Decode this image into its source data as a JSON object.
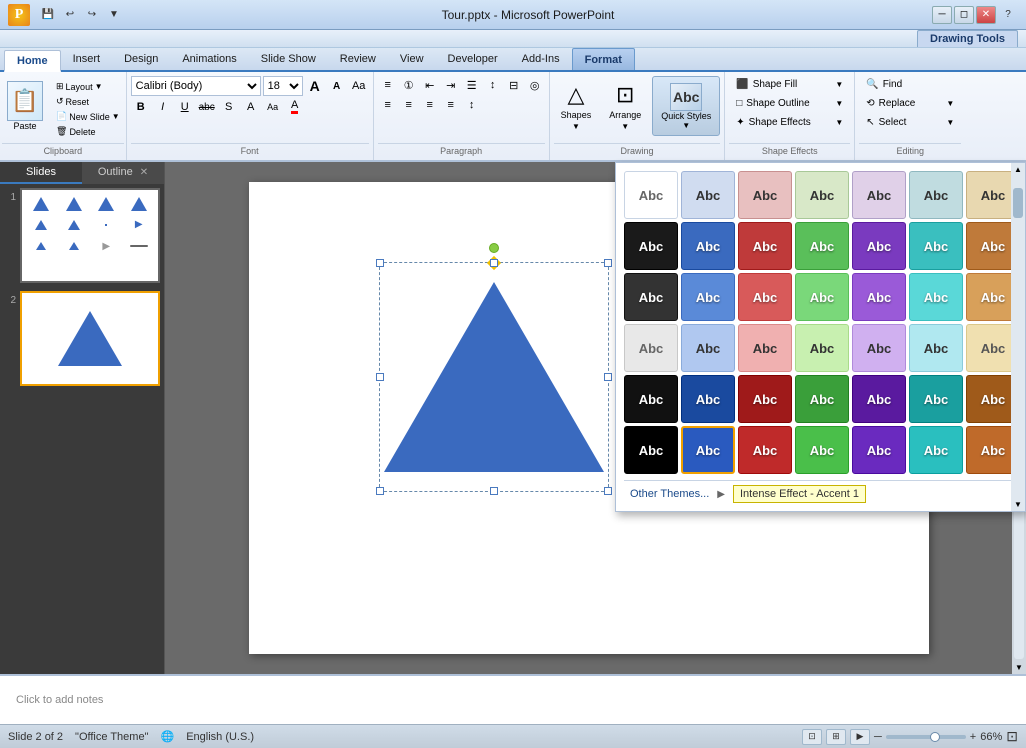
{
  "window": {
    "title": "Tour.pptx - Microsoft PowerPoint",
    "drawing_tools": "Drawing Tools"
  },
  "title_bar": {
    "title": "Tour.pptx - Microsoft PowerPoint",
    "quick_access": [
      "save",
      "undo",
      "redo",
      "customize"
    ],
    "controls": [
      "minimize",
      "restore",
      "close"
    ]
  },
  "tabs": {
    "items": [
      "Home",
      "Insert",
      "Design",
      "Animations",
      "Slide Show",
      "Review",
      "View",
      "Developer",
      "Add-Ins",
      "Format"
    ],
    "active": "Home",
    "format_tab": "Format"
  },
  "ribbon": {
    "groups": {
      "clipboard": {
        "label": "Clipboard",
        "paste": "Paste",
        "layout": "Layout",
        "reset": "Reset",
        "new_slide": "New\nSlide",
        "delete": "Delete"
      },
      "font": {
        "label": "Font",
        "font_name": "Calibri (Body)",
        "font_size": "18",
        "bold": "B",
        "italic": "I",
        "underline": "U",
        "strikethrough": "abc",
        "shadow": "S",
        "char_spacing": "A",
        "font_color": "A",
        "grow": "A",
        "shrink": "A",
        "clear": "A",
        "change_case": "Aa"
      },
      "paragraph": {
        "label": "Paragraph",
        "bullets": "≡",
        "numbering": "≡",
        "decrease": "↔",
        "increase": "↔",
        "columns": "☰",
        "align_left": "≡",
        "center": "≡",
        "align_right": "≡",
        "justify": "≡",
        "line_spacing": "≡",
        "text_direction": "A",
        "align_text": "≡",
        "convert_smartart": "◎"
      },
      "shapes": {
        "label": "Drawing",
        "shapes_btn": "Shapes",
        "arrange_btn": "Arrange",
        "quick_styles_btn": "Quick\nStyles"
      },
      "editing": {
        "label": "Editing",
        "find": "Find",
        "replace": "Replace",
        "select": "Select"
      },
      "shape_effects": {
        "label": "Shape Effects",
        "shape_fill": "Shape Fill",
        "shape_outline": "Shape Outline",
        "shape_effects": "Shape Effects"
      }
    }
  },
  "sidebar": {
    "tabs": [
      "Slides",
      "Outline"
    ],
    "active_tab": "Slides",
    "slides": [
      {
        "num": "1",
        "active": false
      },
      {
        "num": "2",
        "active": true
      }
    ]
  },
  "slide": {
    "notes_placeholder": "Click to add notes"
  },
  "quick_styles_panel": {
    "rows": [
      [
        {
          "bg": "white",
          "border": "#c8d4e4",
          "text_color": "#666",
          "style": "subtle-no-fill"
        },
        {
          "bg": "#d0dcf0",
          "border": "#a0b4d8",
          "text_color": "#333",
          "style": "subtle-light-blue"
        },
        {
          "bg": "#e8c0c0",
          "border": "#c89090",
          "text_color": "#333",
          "style": "subtle-light-red"
        },
        {
          "bg": "#d8e8c8",
          "border": "#a8c898",
          "text_color": "#333",
          "style": "subtle-light-green"
        },
        {
          "bg": "#e0d0e8",
          "border": "#b0a0c8",
          "text_color": "#333",
          "style": "subtle-light-purple"
        },
        {
          "bg": "#c0dce0",
          "border": "#90b8c0",
          "text_color": "#333",
          "style": "subtle-light-teal"
        },
        {
          "bg": "#e8d8b0",
          "border": "#c8b080",
          "text_color": "#333",
          "style": "subtle-light-gold"
        }
      ],
      [
        {
          "bg": "#1a1a1a",
          "border": "#000",
          "text_color": "white",
          "style": "colored-dark"
        },
        {
          "bg": "#3a6abf",
          "border": "#1a4a9f",
          "text_color": "white",
          "style": "colored-blue"
        },
        {
          "bg": "#bf3a3a",
          "border": "#9f1a1a",
          "text_color": "white",
          "style": "colored-red"
        },
        {
          "bg": "#5abf5a",
          "border": "#3a9f3a",
          "text_color": "white",
          "style": "colored-green"
        },
        {
          "bg": "#7a3abf",
          "border": "#5a1a9f",
          "text_color": "white",
          "style": "colored-purple"
        },
        {
          "bg": "#3abfbf",
          "border": "#1a9f9f",
          "text_color": "white",
          "style": "colored-teal"
        },
        {
          "bg": "#bf7a3a",
          "border": "#9f5a1a",
          "text_color": "white",
          "style": "colored-orange"
        }
      ],
      [
        {
          "bg": "#333",
          "border": "#111",
          "text_color": "white",
          "style": "light-dark"
        },
        {
          "bg": "#5a8ad8",
          "border": "#3a6abf",
          "text_color": "white",
          "style": "light-blue"
        },
        {
          "bg": "#d85a5a",
          "border": "#bf3a3a",
          "text_color": "white",
          "style": "light-red"
        },
        {
          "bg": "#7ad87a",
          "border": "#5abf5a",
          "text_color": "white",
          "style": "light-green"
        },
        {
          "bg": "#9a5ad8",
          "border": "#7a3abf",
          "text_color": "white",
          "style": "light-purple"
        },
        {
          "bg": "#5ad8d8",
          "border": "#3abfbf",
          "text_color": "white",
          "style": "light-teal"
        },
        {
          "bg": "#d8a05a",
          "border": "#bf7a3a",
          "text_color": "white",
          "style": "light-orange"
        }
      ],
      [
        {
          "bg": "#e8e8e8",
          "border": "#c8c8c8",
          "text_color": "#666",
          "style": "moderate-default"
        },
        {
          "bg": "#b0c8f0",
          "border": "#8aabdb",
          "text_color": "#333",
          "style": "moderate-blue"
        },
        {
          "bg": "#f0b0b0",
          "border": "#db8a8a",
          "text_color": "#333",
          "style": "moderate-red"
        },
        {
          "bg": "#c8f0b0",
          "border": "#a8db8a",
          "text_color": "#333",
          "style": "moderate-green"
        },
        {
          "bg": "#d0b0f0",
          "border": "#b08adb",
          "text_color": "#333",
          "style": "moderate-purple"
        },
        {
          "bg": "#b0e8f0",
          "border": "#8acbdb",
          "text_color": "#333",
          "style": "moderate-teal"
        },
        {
          "bg": "#f0e0b0",
          "border": "#dbc88a",
          "text_color": "#555",
          "style": "moderate-gold"
        }
      ],
      [
        {
          "bg": "#111",
          "border": "#000",
          "text_color": "white",
          "style": "intense-dark"
        },
        {
          "bg": "#1a4a9f",
          "border": "#003080",
          "text_color": "white",
          "style": "intense-blue"
        },
        {
          "bg": "#9f1a1a",
          "border": "#800000",
          "text_color": "white",
          "style": "intense-red"
        },
        {
          "bg": "#3a9f3a",
          "border": "#208020",
          "text_color": "white",
          "style": "intense-green"
        },
        {
          "bg": "#5a1a9f",
          "border": "#400080",
          "text_color": "white",
          "style": "intense-purple"
        },
        {
          "bg": "#1a9f9f",
          "border": "#008080",
          "text_color": "white",
          "style": "intense-teal"
        },
        {
          "bg": "#9f5a1a",
          "border": "#804000",
          "text_color": "white",
          "style": "intense-orange"
        }
      ],
      [
        {
          "bg": "#000",
          "border": "#000",
          "text_color": "white",
          "style": "intense-effect-dark"
        },
        {
          "bg": "#2a5abf",
          "border": "#f0a000",
          "text_color": "white",
          "style": "intense-effect-blue",
          "selected": true
        },
        {
          "bg": "#bf2a2a",
          "border": "#9f0a0a",
          "text_color": "white",
          "style": "intense-effect-red"
        },
        {
          "bg": "#4abf4a",
          "border": "#2a9f2a",
          "text_color": "white",
          "style": "intense-effect-green"
        },
        {
          "bg": "#6a2abf",
          "border": "#4a0a9f",
          "text_color": "white",
          "style": "intense-effect-purple"
        },
        {
          "bg": "#2abfbf",
          "border": "#0a9f9f",
          "text_color": "white",
          "style": "intense-effect-teal"
        },
        {
          "bg": "#bf6a2a",
          "border": "#9f4a0a",
          "text_color": "white",
          "style": "intense-effect-orange"
        }
      ]
    ],
    "footer": {
      "other_themes": "Other Themes...",
      "tooltip": "Intense Effect - Accent 1"
    }
  },
  "status_bar": {
    "slide_info": "Slide 2 of 2",
    "theme": "\"Office Theme\"",
    "language": "English (U.S.)",
    "zoom": "66%"
  },
  "icons": {
    "paste": "📋",
    "layout": "⊞",
    "shapes": "△",
    "arrange": "⊡",
    "find": "🔍",
    "replace": "⟲",
    "select": "↖",
    "shape_fill": "⬛",
    "shape_outline": "□",
    "shape_effects": "✦",
    "globe": "🌐"
  }
}
